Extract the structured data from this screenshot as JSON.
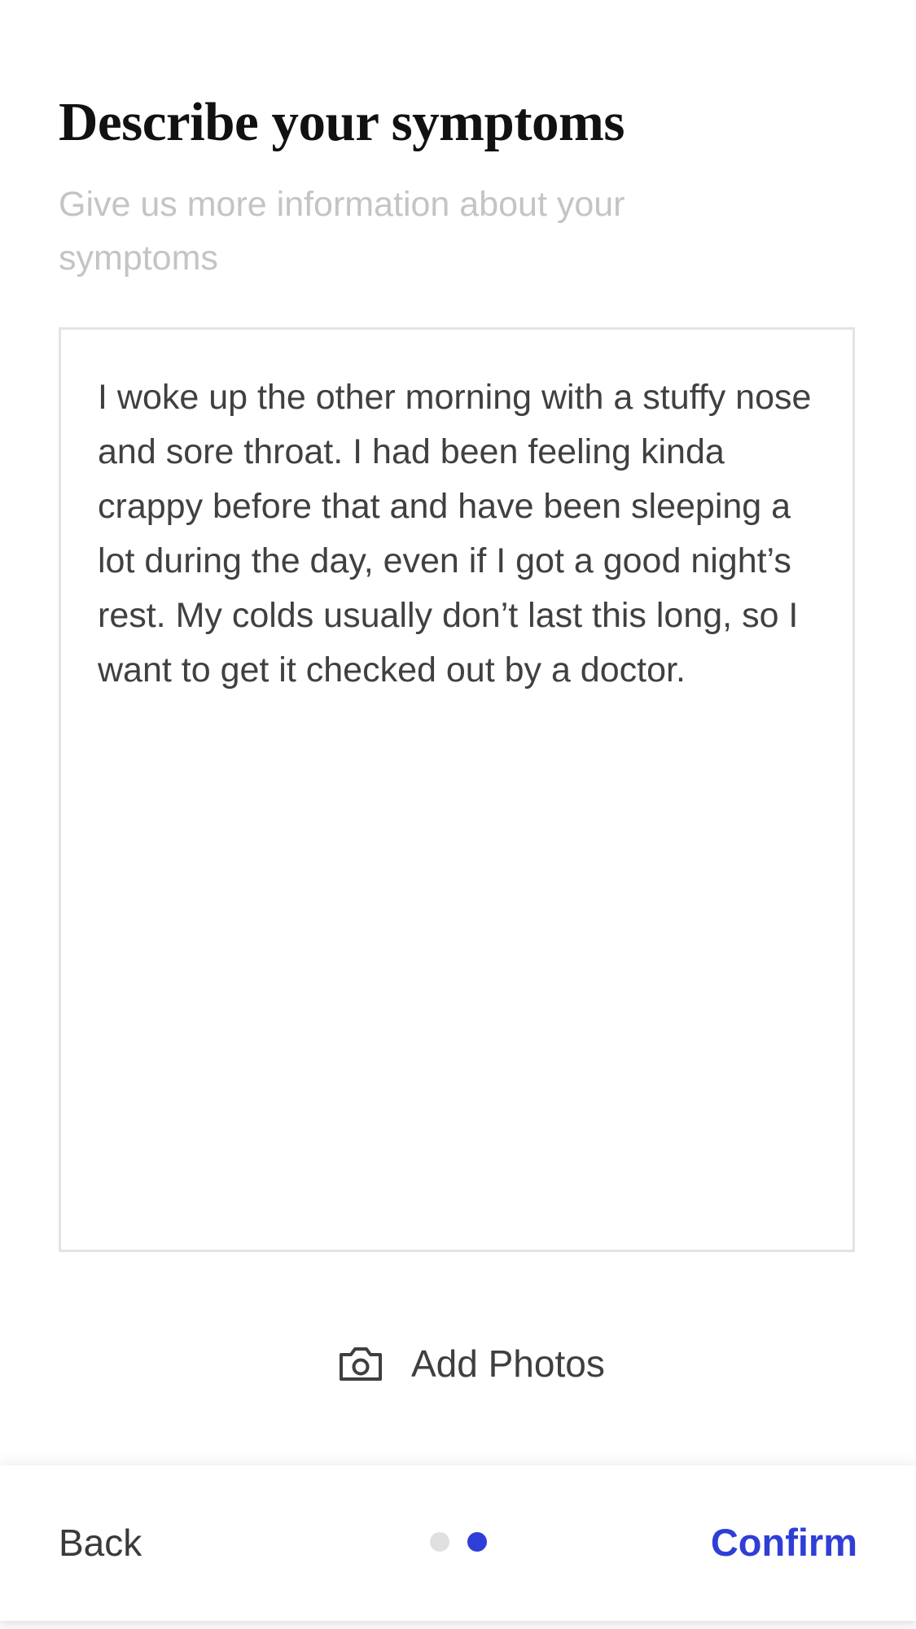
{
  "header": {
    "title": "Describe your symptoms",
    "subtitle": "Give us more information about your symptoms"
  },
  "symptoms_input": {
    "value": "I woke up the other morning with a stuffy nose and sore throat. I had been feeling kinda crappy before that and have been sleeping a lot during the day, even if I got a good night’s rest. My colds usually don’t last this long, so I want to get it checked out by a doctor."
  },
  "add_photos": {
    "label": "Add Photos",
    "icon": "camera-icon"
  },
  "footer": {
    "back_label": "Back",
    "confirm_label": "Confirm",
    "pager": {
      "total": 2,
      "current": 2
    }
  },
  "colors": {
    "accent": "#2f3ed6",
    "dot_inactive": "#e0e0e0",
    "subtitle": "#c4c4c4",
    "body_text": "#404040",
    "border": "#e3e3e3"
  }
}
